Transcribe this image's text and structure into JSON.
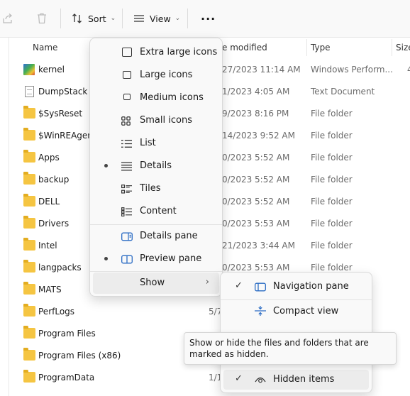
{
  "toolbar": {
    "sort_label": "Sort",
    "view_label": "View",
    "more_label": "···"
  },
  "columns": {
    "name": "Name",
    "date_modified": "e modified",
    "type": "Type",
    "size": "Size"
  },
  "files": [
    {
      "name": "kernel",
      "date": "27/2023 11:14 AM",
      "type": "Windows Perform...",
      "size": "4",
      "icon": "kernel-icon"
    },
    {
      "name": "DumpStack",
      "date": "1/2023 4:05 AM",
      "type": "Text Document",
      "size": "",
      "icon": "text-file-icon"
    },
    {
      "name": "$SysReset",
      "date": "9/2023 8:16 PM",
      "type": "File folder",
      "size": "",
      "icon": "folder-icon"
    },
    {
      "name": "$WinREAgent",
      "date": "14/2023 9:52 AM",
      "type": "File folder",
      "size": "",
      "icon": "folder-icon"
    },
    {
      "name": "Apps",
      "date": "0/2023 5:52 AM",
      "type": "File folder",
      "size": "",
      "icon": "folder-icon"
    },
    {
      "name": "backup",
      "date": "0/2023 5:52 AM",
      "type": "File folder",
      "size": "",
      "icon": "folder-icon"
    },
    {
      "name": "DELL",
      "date": "0/2023 5:52 AM",
      "type": "File folder",
      "size": "",
      "icon": "folder-icon"
    },
    {
      "name": "Drivers",
      "date": "0/2023 5:53 AM",
      "type": "File folder",
      "size": "",
      "icon": "folder-icon"
    },
    {
      "name": "Intel",
      "date": "21/2023 3:44 AM",
      "type": "File folder",
      "size": "",
      "icon": "folder-icon"
    },
    {
      "name": "langpacks",
      "date": "0/2023 5:53 AM",
      "type": "File folder",
      "size": "",
      "icon": "folder-icon"
    },
    {
      "name": "MATS",
      "date": "",
      "type": "",
      "size": "",
      "icon": "folder-icon"
    },
    {
      "name": "PerfLogs",
      "date": "5/7",
      "type": "",
      "size": "",
      "icon": "folder-icon"
    },
    {
      "name": "Program Files",
      "date": "",
      "type": "",
      "size": "",
      "icon": "folder-icon"
    },
    {
      "name": "Program Files (x86)",
      "date": "",
      "type": "",
      "size": "",
      "icon": "folder-icon"
    },
    {
      "name": "ProgramData",
      "date": "1/1",
      "type": "",
      "size": "",
      "icon": "folder-icon"
    }
  ],
  "view_menu": {
    "items": [
      {
        "label": "Extra large icons",
        "icon": "extra-large-icons-icon",
        "selected": false
      },
      {
        "label": "Large icons",
        "icon": "large-icons-icon",
        "selected": false
      },
      {
        "label": "Medium icons",
        "icon": "medium-icons-icon",
        "selected": false
      },
      {
        "label": "Small icons",
        "icon": "small-icons-icon",
        "selected": false
      },
      {
        "label": "List",
        "icon": "list-icon",
        "selected": false
      },
      {
        "label": "Details",
        "icon": "details-icon",
        "selected": true
      },
      {
        "label": "Tiles",
        "icon": "tiles-icon",
        "selected": false
      },
      {
        "label": "Content",
        "icon": "content-icon",
        "selected": false
      }
    ],
    "pane_items": [
      {
        "label": "Details pane",
        "icon": "details-pane-icon",
        "selected": false
      },
      {
        "label": "Preview pane",
        "icon": "preview-pane-icon",
        "selected": true
      }
    ],
    "show_label": "Show"
  },
  "show_submenu": {
    "items": [
      {
        "label": "Navigation pane",
        "checked": true,
        "icon": "navigation-pane-icon"
      },
      {
        "label": "Compact view",
        "checked": false,
        "icon": "compact-view-icon"
      },
      {
        "label": "Hidden items",
        "checked": true,
        "icon": "eye-icon"
      }
    ]
  },
  "tooltip": {
    "text": "Show or hide the files and folders that are marked as hidden."
  }
}
